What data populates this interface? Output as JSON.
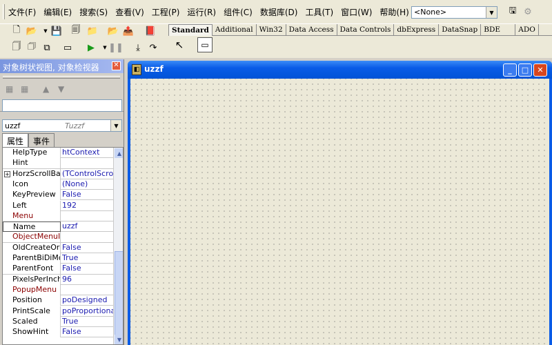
{
  "menu": {
    "items": [
      "文件(F)",
      "编辑(E)",
      "搜索(S)",
      "查看(V)",
      "工程(P)",
      "运行(R)",
      "组件(C)",
      "数据库(D)",
      "工具(T)",
      "窗口(W)",
      "帮助(H)"
    ]
  },
  "desktop_combo": {
    "value": "<None>"
  },
  "palette": {
    "tabs": [
      "Standard",
      "Additional",
      "Win32",
      "Data Access",
      "Data Controls",
      "dbExpress",
      "DataSnap",
      "BDE",
      "ADO"
    ],
    "active": "Standard"
  },
  "inspector": {
    "title": "对象树状视图, 对象检视器",
    "object_name": "uzzf",
    "object_type": "Tuzzf",
    "tabs": [
      "属性",
      "事件"
    ],
    "properties": [
      {
        "name": "HelpType",
        "value": "htContext",
        "kind": "prop"
      },
      {
        "name": "Hint",
        "value": "",
        "kind": "prop"
      },
      {
        "name": "HorzScrollBar",
        "value": "(TControlScrollB",
        "kind": "prop",
        "expandable": true
      },
      {
        "name": "Icon",
        "value": "(None)",
        "kind": "prop"
      },
      {
        "name": "KeyPreview",
        "value": "False",
        "kind": "prop"
      },
      {
        "name": "Left",
        "value": "192",
        "kind": "prop"
      },
      {
        "name": "Menu",
        "value": "",
        "kind": "event"
      },
      {
        "name": "Name",
        "value": "uzzf",
        "kind": "prop",
        "selected": true
      },
      {
        "name": "ObjectMenuItem",
        "value": "",
        "kind": "event"
      },
      {
        "name": "OldCreateOrder",
        "value": "False",
        "kind": "prop"
      },
      {
        "name": "ParentBiDiMode",
        "value": "True",
        "kind": "prop"
      },
      {
        "name": "ParentFont",
        "value": "False",
        "kind": "prop"
      },
      {
        "name": "PixelsPerInch",
        "value": "96",
        "kind": "prop"
      },
      {
        "name": "PopupMenu",
        "value": "",
        "kind": "event"
      },
      {
        "name": "Position",
        "value": "poDesigned",
        "kind": "prop"
      },
      {
        "name": "PrintScale",
        "value": "poProportional",
        "kind": "prop"
      },
      {
        "name": "Scaled",
        "value": "True",
        "kind": "prop"
      },
      {
        "name": "ShowHint",
        "value": "False",
        "kind": "prop"
      }
    ]
  },
  "form": {
    "title": "uzzf"
  }
}
